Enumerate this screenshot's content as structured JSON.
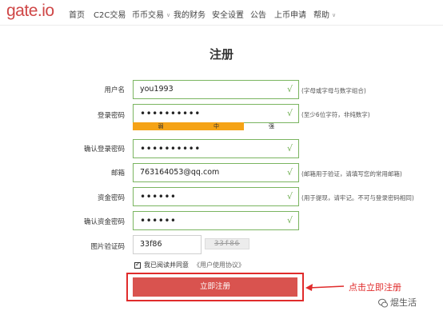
{
  "brand": {
    "logo_text": "gate",
    "logo_dot": ".",
    "logo_suffix": "io"
  },
  "nav": {
    "home": "首页",
    "c2c": "C2C交易",
    "coin_trade": "币币交易",
    "my_finance": "我的财务",
    "security": "安全设置",
    "notice": "公告",
    "listing": "上币申请",
    "help": "帮助"
  },
  "page_title": "注册",
  "form": {
    "username": {
      "label": "用户名",
      "value": "you1993",
      "hint": "(字母或字母与数字组合)",
      "check": "√"
    },
    "login_password": {
      "label": "登录密码",
      "value": "••••••••••",
      "hint": "(至少6位字符，非纯数字)",
      "check": "√"
    },
    "strength": {
      "weak": "弱",
      "medium": "中",
      "strong": "强",
      "level": "medium",
      "weak_color": "#f5a316",
      "medium_color": "#f5a316"
    },
    "confirm_login_password": {
      "label": "确认登录密码",
      "value": "••••••••••",
      "check": "√"
    },
    "email": {
      "label": "邮箱",
      "value": "763164053@qq.com",
      "hint": "(邮箱用于验证，请填写您的常用邮箱)",
      "check": "√"
    },
    "fund_password": {
      "label": "资金密码",
      "value": "••••••",
      "hint": "(用于提现，请牢记。不可与登录密码相同)",
      "check": "√"
    },
    "confirm_fund_password": {
      "label": "确认资金密码",
      "value": "••••••",
      "check": "√"
    },
    "captcha": {
      "label": "图片验证码",
      "value": "33f86",
      "image_text": "33f86"
    },
    "agree": {
      "checked": true,
      "text": "我已阅读并同意",
      "link": "《用户使用协议》"
    },
    "submit_label": "立即注册"
  },
  "annotation": {
    "text": "点击立即注册",
    "color": "#e02b2b"
  },
  "watermark": {
    "text": "焜生活"
  },
  "colors": {
    "accent": "#d9534f",
    "valid_border": "#7ab560",
    "brand": "#cf4747"
  }
}
